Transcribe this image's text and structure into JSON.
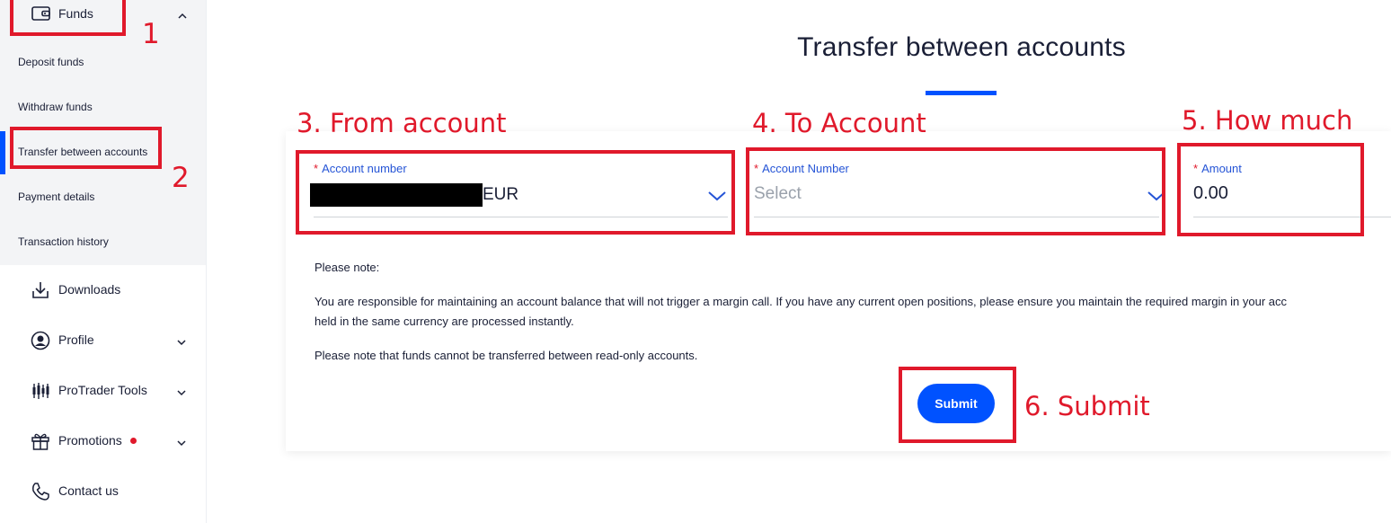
{
  "sidebar": {
    "funds": {
      "label": "Funds",
      "icon": "wallet-icon"
    },
    "sub_items": [
      {
        "label": "Deposit funds"
      },
      {
        "label": "Withdraw funds"
      },
      {
        "label": "Transfer between accounts",
        "active": true
      },
      {
        "label": "Payment details"
      },
      {
        "label": "Transaction history"
      }
    ],
    "nav_items": [
      {
        "label": "Downloads",
        "icon": "download-icon"
      },
      {
        "label": "Profile",
        "icon": "user-circle-icon"
      },
      {
        "label": "ProTrader Tools",
        "icon": "candlestick-icon"
      },
      {
        "label": "Promotions",
        "icon": "gift-icon"
      },
      {
        "label": "Contact us",
        "icon": "phone-icon"
      }
    ]
  },
  "page": {
    "title": "Transfer between accounts"
  },
  "form": {
    "from": {
      "label": "Account number",
      "value": "EUR"
    },
    "to": {
      "label": "Account Number",
      "placeholder": "Select"
    },
    "amount": {
      "label": "Amount",
      "value": "0.00"
    },
    "required_mark": "*"
  },
  "notes": {
    "heading": "Please note:",
    "line1": "You are responsible for maintaining an account balance that will not trigger a margin call. If you have any current open positions, please ensure you maintain the required margin in your acc",
    "line2": "held in the same currency are processed instantly.",
    "line3": "Please note that funds cannot be transferred between read-only accounts."
  },
  "submit": {
    "label": "Submit"
  },
  "annotations": {
    "a1": "1",
    "a2": "2",
    "a3": "3. From account",
    "a4": "4. To Account",
    "a5": "5. How much",
    "a6": "6. Submit"
  },
  "colors": {
    "accent": "#0052ff",
    "annotation": "#e0192b",
    "label_blue": "#2554d6"
  }
}
